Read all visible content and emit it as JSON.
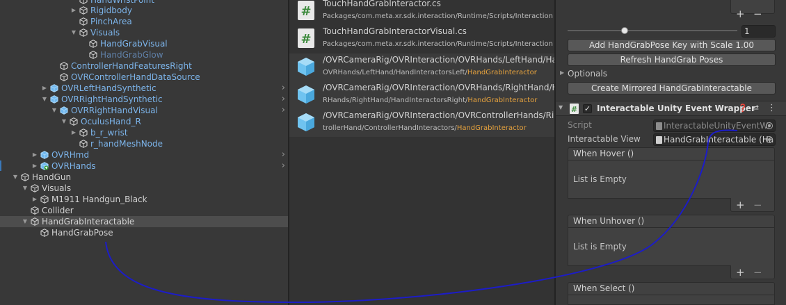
{
  "hierarchy": {
    "items": [
      {
        "label": "HandWristPoint",
        "color": "blue"
      },
      {
        "label": "Rigidbody",
        "color": "blue"
      },
      {
        "label": "PinchArea",
        "color": "blue"
      },
      {
        "label": "Visuals",
        "color": "blue"
      },
      {
        "label": "HandGrabVisual",
        "color": "blue"
      },
      {
        "label": "HandGrabGlow",
        "color": "dimblue"
      },
      {
        "label": "ControllerHandFeaturesRight",
        "color": "blue"
      },
      {
        "label": "OVRControllerHandDataSource",
        "color": "blue"
      },
      {
        "label": "OVRLeftHandSynthetic",
        "color": "blue"
      },
      {
        "label": "OVRRightHandSynthetic",
        "color": "blue"
      },
      {
        "label": "OVRRightHandVisual",
        "color": "blue"
      },
      {
        "label": "OculusHand_R",
        "color": "blue"
      },
      {
        "label": "b_r_wrist",
        "color": "blue"
      },
      {
        "label": "r_handMeshNode",
        "color": "blue"
      },
      {
        "label": "OVRHmd",
        "color": "blue"
      },
      {
        "label": "OVRHands",
        "color": "blue"
      },
      {
        "label": "HandGun",
        "color": "white"
      },
      {
        "label": "Visuals",
        "color": "white"
      },
      {
        "label": "M1911 Handgun_Black",
        "color": "white"
      },
      {
        "label": "Collider",
        "color": "white"
      },
      {
        "label": "HandGrabInteractable",
        "color": "white"
      },
      {
        "label": "HandGrabPose",
        "color": "white"
      }
    ]
  },
  "results": {
    "items": [
      {
        "title": "TouchHandGrabInteractor.cs",
        "path": "Packages/com.meta.xr.sdk.interaction/Runtime/Scripts/Interaction",
        "highlight": "",
        "icon": "csharp-script-icon"
      },
      {
        "title": "TouchHandGrabInteractorVisual.cs",
        "path": "Packages/com.meta.xr.sdk.interaction/Runtime/Scripts/Interaction",
        "highlight": "",
        "icon": "csharp-script-icon"
      },
      {
        "title": "/OVRCameraRig/OVRInteraction/OVRHands/LeftHand/Ha",
        "path": "OVRHands/LeftHand/HandInteractorsLeft/",
        "highlight": "HandGrabInteractor",
        "icon": "prefab-cube-icon"
      },
      {
        "title": "/OVRCameraRig/OVRInteraction/OVRHands/RightHand/H",
        "path": "RHands/RightHand/HandInteractorsRight/",
        "highlight": "HandGrabInteractor",
        "icon": "prefab-cube-icon"
      },
      {
        "title": "/OVRCameraRig/OVRInteraction/OVRControllerHands/Rig",
        "path": "trollerHand/ControllerHandInteractors/",
        "highlight": "HandGrabInteractor",
        "icon": "prefab-cube-icon"
      }
    ]
  },
  "inspector": {
    "plus": "+",
    "minus": "−",
    "slider_value": "1",
    "slider_level": 0.33,
    "add_pose_button": "Add HandGrabPose Key with Scale 1.00",
    "refresh_button": "Refresh HandGrab Poses",
    "optionals_label": "Optionals",
    "create_mirrored_button": "Create Mirrored HandGrabInteractable",
    "component_title": "Interactable Unity Event Wrapper",
    "script_label": "Script",
    "script_value": "InteractableUnityEventWr",
    "interactable_view_label": "Interactable View",
    "interactable_view_value": "HandGrabInteractable (Ha",
    "when_hover_label": "When Hover ()",
    "when_unhover_label": "When Unhover ()",
    "when_select_label": "When Select ()",
    "list_empty": "List is Empty"
  },
  "colors": {
    "accent_blue": "#7cb4ea",
    "highlight_orange": "#e7a33e",
    "annotation_stroke": "#1c1cc8"
  }
}
